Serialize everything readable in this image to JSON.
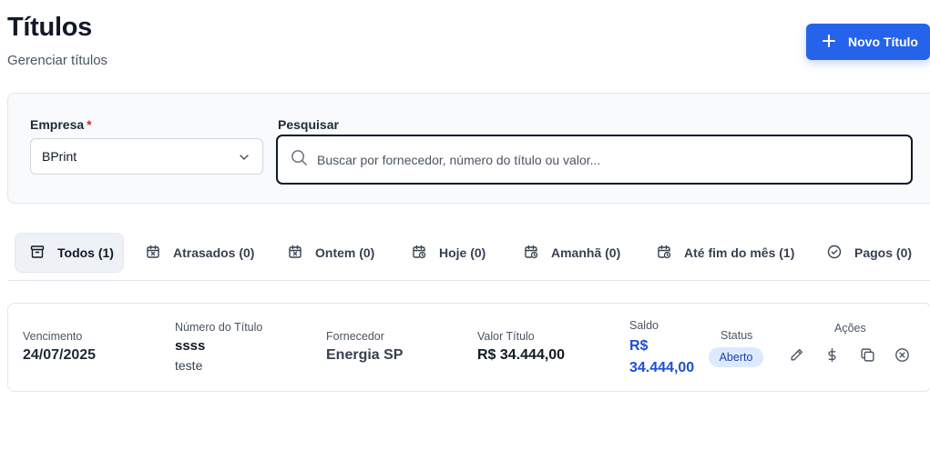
{
  "header": {
    "title": "Títulos",
    "subtitle": "Gerenciar títulos",
    "new_button_label": "Novo Título"
  },
  "filters": {
    "empresa_label": "Empresa",
    "empresa_required_mark": "*",
    "empresa_value": "BPrint",
    "search_label": "Pesquisar",
    "search_placeholder": "Buscar por fornecedor, número do título ou valor..."
  },
  "tabs": [
    {
      "label": "Todos (1)",
      "icon": "archive-icon",
      "active": true
    },
    {
      "label": "Atrasados (0)",
      "icon": "calendar-x-icon",
      "active": false
    },
    {
      "label": "Ontem (0)",
      "icon": "calendar-x-icon",
      "active": false
    },
    {
      "label": "Hoje (0)",
      "icon": "calendar-clock-icon",
      "active": false
    },
    {
      "label": "Amanhã (0)",
      "icon": "calendar-clock-icon",
      "active": false
    },
    {
      "label": "Até fim do mês (1)",
      "icon": "calendar-clock-icon",
      "active": false
    },
    {
      "label": "Pagos (0)",
      "icon": "check-circle-icon",
      "active": false
    }
  ],
  "titles": [
    {
      "vencimento_label": "Vencimento",
      "vencimento": "24/07/2025",
      "numero_label": "Número do Título",
      "numero": "ssss",
      "descricao": "teste",
      "fornecedor_label": "Fornecedor",
      "fornecedor": "Energia SP",
      "valor_label": "Valor Título",
      "valor": "R$ 34.444,00",
      "saldo_label": "Saldo",
      "saldo": "R$ 34.444,00",
      "status_label": "Status",
      "status": "Aberto",
      "acoes_label": "Ações"
    }
  ],
  "colors": {
    "primary": "#2563eb",
    "saldo": "#1d4ed8",
    "badge_bg": "#dbeafe",
    "required": "#dc2626"
  }
}
